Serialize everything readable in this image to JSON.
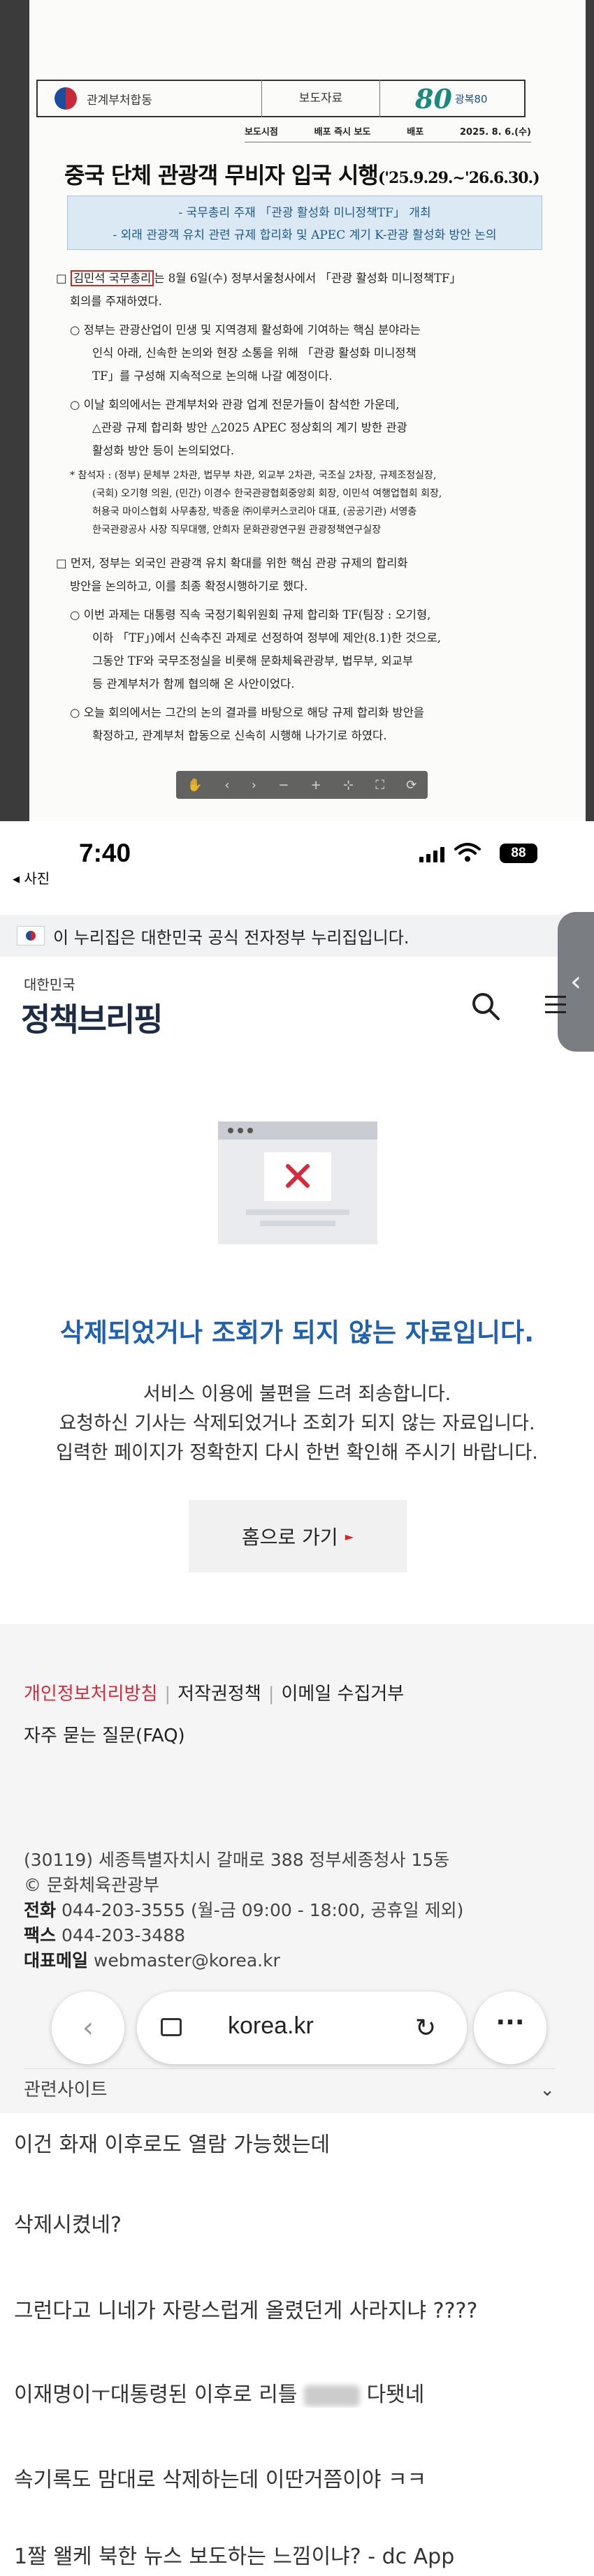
{
  "document": {
    "header": {
      "department": "관계부처합동",
      "kind": "보도자료",
      "anniversary_big": "80",
      "anniversary_small": "광복80",
      "embargo_label": "보도시점",
      "embargo_value": "배포 즉시 보도",
      "distribution_label": "배포",
      "distribution_date": "2025. 8. 6.(수)"
    },
    "title": "중국 단체 관광객 무비자 입국 시행",
    "title_period": "('25.9.29.~'26.6.30.)",
    "subtitle_1": "- 국무총리 주재 「관광 활성화 미니정책TF」 개최",
    "subtitle_2": "- 외래 관광객 유치 관련 규제 합리화 및 APEC 계기 K-관광 활성화 방안 논의",
    "para1_name": "김민석 국무총리",
    "para1_text": "는 8월 6일(수) 정부서울청사에서 「관광 활성화 미니정책TF」",
    "para1_line2": "회의를 주재하였다.",
    "para2_line1": "○ 정부는 관광산업이 민생 및 지역경제 활성화에 기여하는 핵심 분야라는",
    "para2_line2": "인식 아래, 신속한 논의와 현장 소통을 위해 「관광 활성화 미니정책",
    "para2_line3": "TF」를 구성해 지속적으로 논의해 나갈 예정이다.",
    "para3_line1": "○ 이날 회의에서는 관계부처와 관광 업계 전문가들이 참석한 가운데,",
    "para3_line2": "△관광 규제 합리화 방안 △2025 APEC 정상회의 계기 방한 관광",
    "para3_line3": "활성화 방안 등이 논의되었다.",
    "attendees_1": "* 참석자 : (정부) 문체부 2차관, 법무부 차관, 외교부 2차관, 국조실 2차장, 규제조정실장,",
    "attendees_2": "(국회) 오기형 의원, (민간) 이경수 한국관광협회중앙회 회장, 이민석 여행업협회 회장,",
    "attendees_3": "허용국 마이스협회 사무총장, 박종윤 ㈜이루커스코리아 대표, (공공기관) 서영충",
    "attendees_4": "한국관광공사 사장 직무대행, 안희자 문화관광연구원 관광정책연구실장",
    "para4_line1": "□ 먼저, 정부는 외국인 관광객 유치 확대를 위한 핵심 관광 규제의 합리화",
    "para4_line2": "방안을 논의하고, 이를 최종 확정시행하기로 했다.",
    "para5_line1": "○ 이번 과제는 대통령 직속 국정기획위원회 규제 합리화 TF(팀장 : 오기형,",
    "para5_line2": "이하 「TF」)에서 신속추진 과제로 선정하여 정부에 제안(8.1)한 것으로,",
    "para5_line3": "그동안 TF와 국무조정실을 비롯해 문화체육관광부, 법무부, 외교부",
    "para5_line4": "등 관계부처가 함께 협의해 온 사안이었다.",
    "para6_line1": "○ 오늘 회의에서는 그간의 논의 결과를 바탕으로 해당 규제 합리화 방안을",
    "para6_line2": "확정하고, 관계부처 합동으로 신속히 시행해 나가기로 하였다."
  },
  "phone": {
    "status": {
      "time": "7:40",
      "back_label": "◂ 사진",
      "battery": "88"
    },
    "gov_banner": "이 누리집은 대한민국 공식 전자정부 누리집입니다.",
    "logo_small": "대한민국",
    "logo_main": "정책브리핑",
    "side_tab_icon": "chevron-left-icon",
    "error_title": "삭제되었거나 조회가 되지 않는 자료입니다.",
    "error_msg_1": "서비스 이용에 불편을 드려 죄송합니다.",
    "error_msg_2": "요청하신 기사는 삭제되었거나 조회가 되지 않는 자료입니다.",
    "error_msg_3": "입력한 페이지가 정확한지 다시 한번 확인해 주시기 바랍니다.",
    "home_button": "홈으로 가기",
    "footer_links": {
      "privacy": "개인정보처리방침",
      "copyright": "저작권정책",
      "email": "이메일 수집거부",
      "faq": "자주 묻는 질문(FAQ)"
    },
    "address": "(30119) 세종특별자치시 갈매로 388 정부세종청사 15동",
    "copyright_line": "© 문화체육관광부",
    "phone_label": "전화",
    "phone_value": "044-203-3555 (월-금 09:00 - 18:00, 공휴일 제외)",
    "fax_label": "팩스",
    "fax_value": "044-203-3488",
    "email_label": "대표메일",
    "email_value": "webmaster@korea.kr",
    "url": "korea.kr",
    "related_sites": "관련사이트",
    "accent_red": "#d72a3a",
    "accent_blue": "#2060b0"
  },
  "comments": [
    "이건 화재 이후로도 열람 가능했는데",
    "삭제시켰네?",
    "그런다고 니네가 자랑스럽게 올렸던게 사라지냐 ????",
    "이재명이ㅜ대통령된 이후로 리틀",
    "다됏네",
    "속기록도 맘대로 삭제하는데 이딴거쯤이야 ㅋㅋ",
    "1짤 왤케 북한 뉴스 보도하는 느낌이냐? - dc App"
  ]
}
